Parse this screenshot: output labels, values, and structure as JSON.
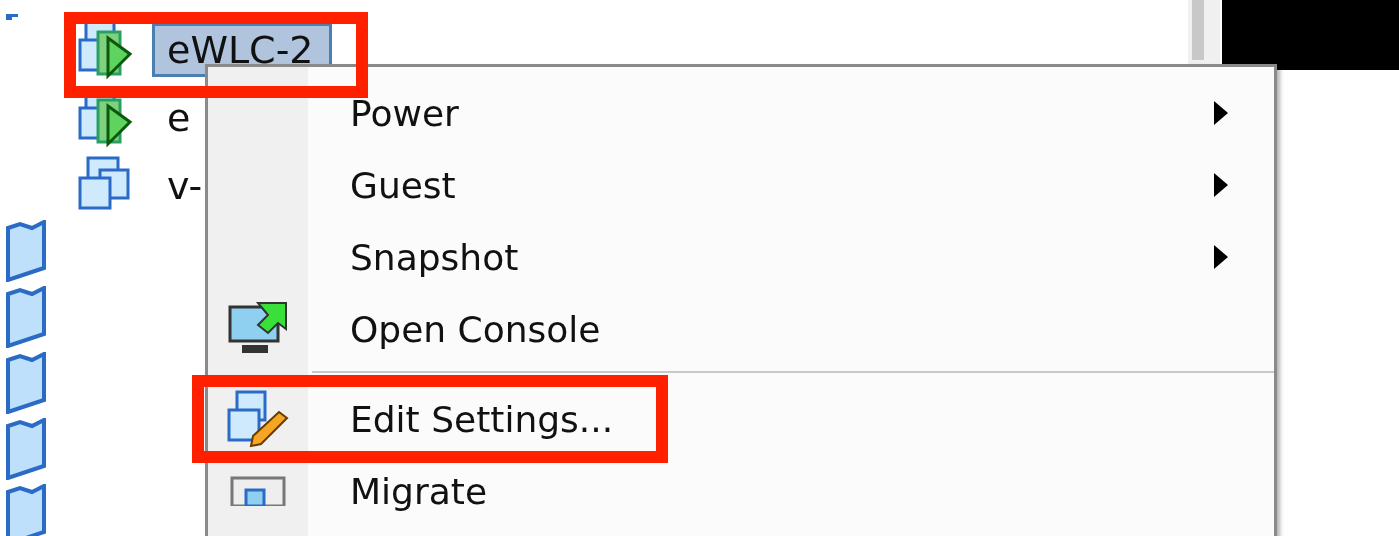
{
  "tree": {
    "items": [
      {
        "label": "eWLC-2",
        "kind": "vm-on",
        "selected": true,
        "highlighted": true
      },
      {
        "label": "e",
        "kind": "vm-on",
        "selected": false,
        "highlighted": false
      },
      {
        "label": "v-",
        "kind": "vm-off",
        "selected": false,
        "highlighted": false
      }
    ]
  },
  "context_menu": {
    "items": [
      {
        "label": "Power",
        "kind": "submenu",
        "highlighted": false
      },
      {
        "label": "Guest",
        "kind": "submenu",
        "highlighted": false
      },
      {
        "label": "Snapshot",
        "kind": "submenu",
        "highlighted": false
      },
      {
        "label": "Open Console",
        "kind": "console",
        "highlighted": false
      },
      {
        "kind": "separator"
      },
      {
        "label": "Edit Settings...",
        "kind": "edit",
        "highlighted": true
      },
      {
        "label": "Migrate",
        "kind": "migrate",
        "highlighted": false
      }
    ]
  }
}
